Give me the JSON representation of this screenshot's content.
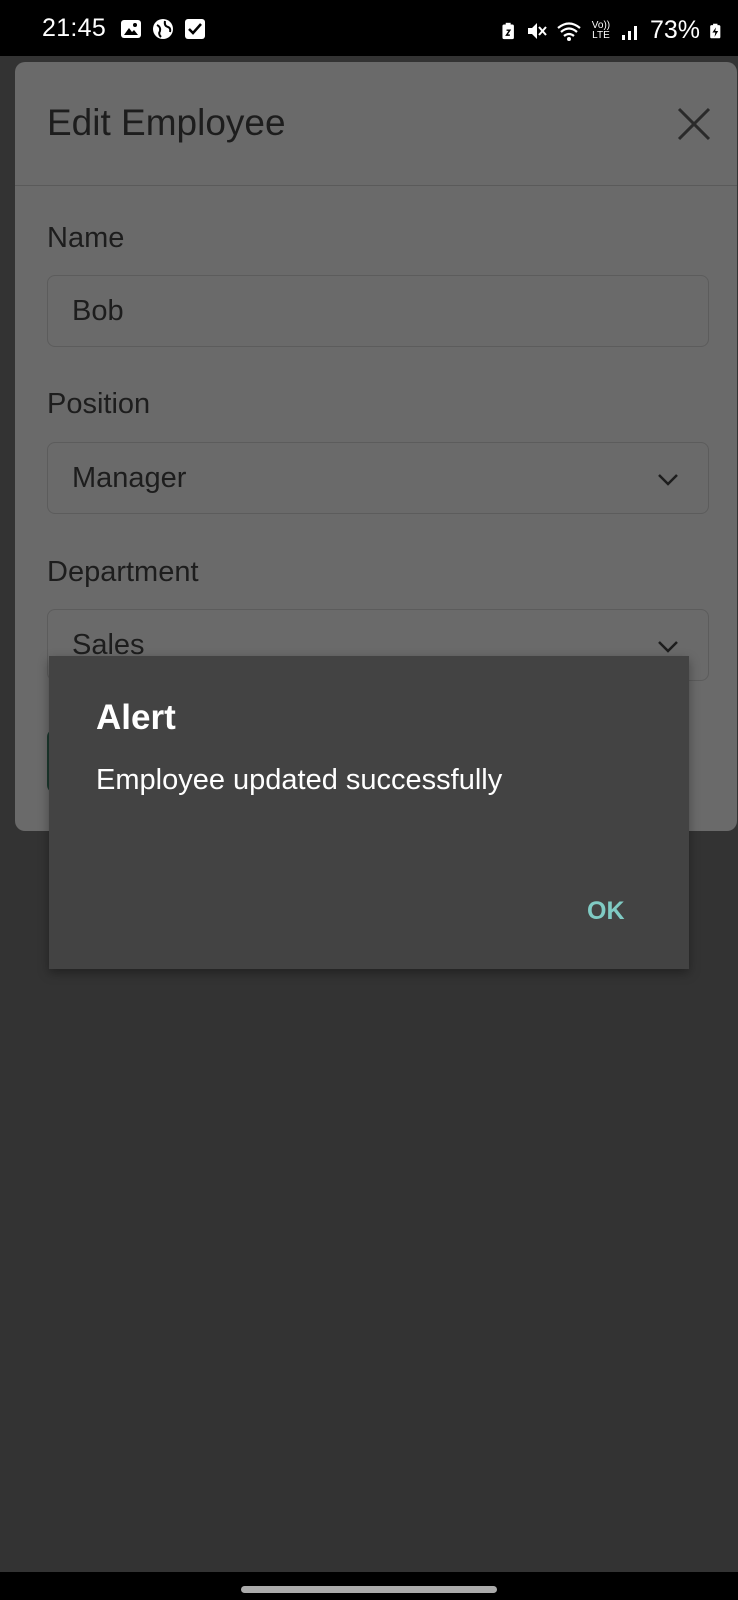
{
  "status_bar": {
    "time": "21:45",
    "left_icons": [
      "image-icon",
      "vpn-globe-icon",
      "checkbox-notification-icon"
    ],
    "right_icons": [
      "battery-saver-icon",
      "mute-icon",
      "wifi-icon",
      "volte-icon",
      "signal-icon",
      "battery-charging-icon"
    ],
    "volte_label": "Vo)) LTE",
    "battery": "73%"
  },
  "modal": {
    "title": "Edit Employee",
    "fields": [
      {
        "label": "Name",
        "value": "Bob",
        "type": "text"
      },
      {
        "label": "Position",
        "value": "Manager",
        "type": "select"
      },
      {
        "label": "Department",
        "value": "Sales",
        "type": "select"
      }
    ]
  },
  "alert": {
    "title": "Alert",
    "message": "Employee updated successfully",
    "ok_label": "OK"
  },
  "colors": {
    "background": "#333333",
    "modal_bg": "#6a6a6a",
    "dialog_bg": "#434343",
    "accent": "#80cbc4"
  }
}
